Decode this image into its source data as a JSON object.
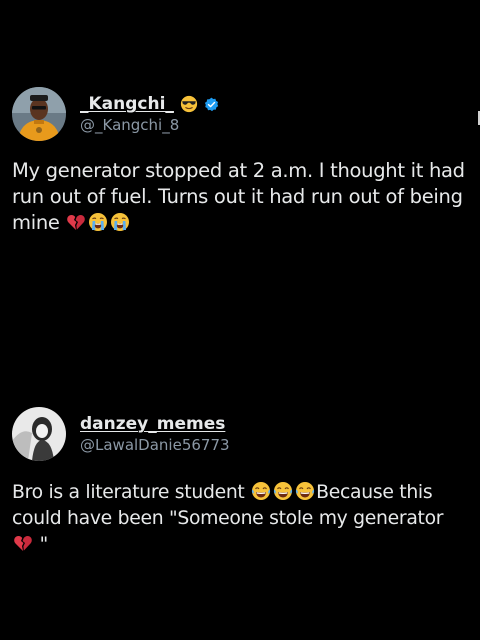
{
  "posts": [
    {
      "display_name": "_Kangchi_",
      "name_emoji": "sunglasses-face-emoji",
      "verified": true,
      "handle": "@_Kangchi_8",
      "text_1": "My generator stopped at 2 a.m. I thought it had run out of fuel. Turns out it had run out of being mine",
      "trailing_emojis": [
        "broken-heart-emoji",
        "loudly-crying-face-emoji",
        "loudly-crying-face-emoji"
      ]
    },
    {
      "display_name": "danzey_memes",
      "verified": false,
      "handle": "@LawalDanie56773",
      "text_1": "Bro is a literature student",
      "middle_emojis": [
        "tears-of-joy-emoji",
        "tears-of-joy-emoji",
        "tears-of-joy-emoji"
      ],
      "text_2": "Because this could have been \"Someone stole my generator",
      "text_3": " \""
    }
  ],
  "colors": {
    "background": "#000000",
    "text": "#e7e9ea",
    "handle": "#8b98a5",
    "verified": "#1d9bf0"
  }
}
